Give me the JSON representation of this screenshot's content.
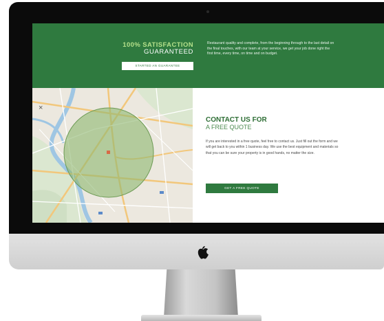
{
  "banner": {
    "line1": "100% SATISFACTION",
    "line2": "GUARANTEED",
    "button_label": "STARTED AN GUARANTEE",
    "text": "Restaurant quality and complete, from the beginning through to the last detail on the final touches, with our team at your service, we get your job done right the first time, every time, on time and on budget."
  },
  "map": {
    "close_label": "×"
  },
  "contact": {
    "title": "CONTACT US FOR",
    "subtitle": "A FREE QUOTE",
    "body": "If you are interested in a free quote, feel free to contact us. Just fill out the form and we will get back to you within 1 business day. We use the best equipment and materials so that you can be sure your property is in good hands, no matter the size.",
    "button_label": "GET A FREE QUOTE"
  },
  "colors": {
    "brand_green": "#2f7a3f",
    "accent_light_green": "#b4e08a"
  },
  "icons": {
    "logo": "apple-logo-icon",
    "close": "close-icon"
  }
}
